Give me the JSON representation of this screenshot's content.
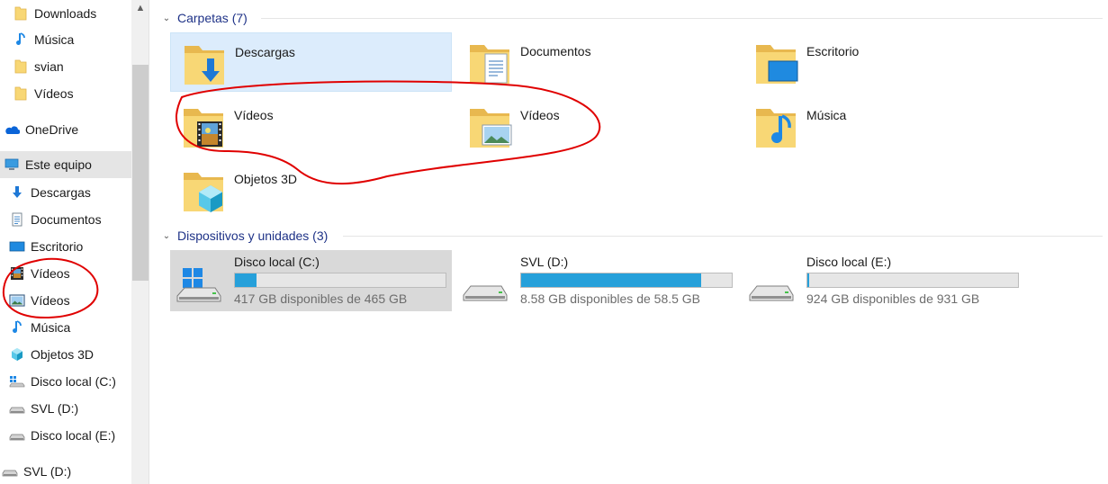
{
  "sidebar": {
    "items": [
      {
        "label": "Downloads",
        "icon": "folder-icon"
      },
      {
        "label": "Música",
        "icon": "music-note-icon"
      },
      {
        "label": "svian",
        "icon": "folder-icon"
      },
      {
        "label": "Vídeos",
        "icon": "folder-icon"
      },
      {
        "label": "OneDrive",
        "icon": "onedrive-cloud-icon"
      },
      {
        "label": "Este equipo",
        "icon": "this-pc-icon"
      },
      {
        "label": "Descargas",
        "icon": "download-arrow-icon"
      },
      {
        "label": "Documentos",
        "icon": "documents-icon"
      },
      {
        "label": "Escritorio",
        "icon": "desktop-icon"
      },
      {
        "label": "Vídeos",
        "icon": "film-strip-icon"
      },
      {
        "label": "Vídeos",
        "icon": "picture-icon"
      },
      {
        "label": "Música",
        "icon": "music-note-icon"
      },
      {
        "label": "Objetos 3D",
        "icon": "cube-3d-icon"
      },
      {
        "label": "Disco local (C:)",
        "icon": "windows-drive-icon"
      },
      {
        "label": "SVL (D:)",
        "icon": "drive-icon"
      },
      {
        "label": "Disco local (E:)",
        "icon": "drive-icon"
      },
      {
        "label": "SVL (D:)",
        "icon": "drive-icon"
      }
    ],
    "selected": "Este equipo"
  },
  "folders_group": {
    "header": "Carpetas (7)",
    "items": [
      {
        "label": "Descargas",
        "icon": "downloads-folder-icon"
      },
      {
        "label": "Documentos",
        "icon": "documents-folder-icon"
      },
      {
        "label": "Escritorio",
        "icon": "desktop-folder-icon"
      },
      {
        "label": "Vídeos",
        "icon": "videos-film-folder-icon"
      },
      {
        "label": "Vídeos",
        "icon": "videos-picture-folder-icon"
      },
      {
        "label": "Música",
        "icon": "music-folder-icon"
      },
      {
        "label": "Objetos 3D",
        "icon": "3d-objects-folder-icon"
      }
    ]
  },
  "devices_group": {
    "header": "Dispositivos y unidades (3)",
    "items": [
      {
        "label": "Disco local (C:)",
        "free_text": "417 GB disponibles de 465 GB",
        "used_fraction": 0.103,
        "icon": "windows-drive-icon"
      },
      {
        "label": "SVL (D:)",
        "free_text": "8.58 GB disponibles de 58.5 GB",
        "used_fraction": 0.853,
        "icon": "drive-icon"
      },
      {
        "label": "Disco local (E:)",
        "free_text": "924 GB disponibles de 931 GB",
        "used_fraction": 0.008,
        "icon": "drive-icon"
      }
    ]
  },
  "colors": {
    "accent": "#26a0da",
    "group_header": "#1e3287",
    "folder": "#f8d775",
    "annotation": "#e00000"
  }
}
